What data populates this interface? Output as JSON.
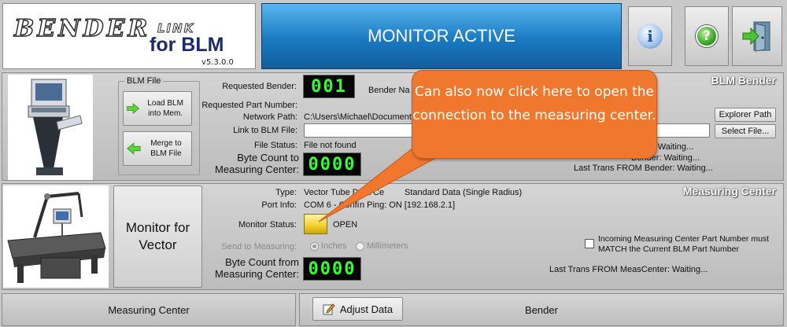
{
  "header": {
    "logo_word": "BENDER",
    "logo_link": "LINK",
    "logo_sub": "for BLM",
    "version": "v5.3.0.0",
    "banner": "MONITOR ACTIVE"
  },
  "blm_bender": {
    "title": "BLM Bender",
    "blm_file_group": "BLM File",
    "load_label": "Load BLM into Mem.",
    "merge_label": "Merge to BLM File",
    "requested_bender_label": "Requested Bender:",
    "requested_bender_value": "001",
    "bender_name_label": "Bender Na",
    "requested_part_label": "Requested Part Number:",
    "network_path_label": "Network Path:",
    "network_path_value": "C:\\Users\\Michael\\Documents",
    "link_file_label": "Link to BLM File:",
    "file_status_label": "File Status:",
    "file_status_value": "File not found",
    "byte_count_label": "Byte Count to Measuring Center:",
    "byte_count_value": "0000",
    "explorer_button": "Explorer Path",
    "select_file_button": "Select File...",
    "trans_line1": "r: Waiting...",
    "trans_line2": "Bender: Waiting...",
    "trans_line3": "Last Trans FROM Bender: Waiting..."
  },
  "measuring_center": {
    "title": "Measuring Center",
    "monitor_button": "Monitor for Vector",
    "type_label": "Type:",
    "type_value": "Vector Tube Data Ce",
    "type_value2": "Standard Data (Single Radius)",
    "port_label": "Port Info:",
    "port_value": "COM 6 - Confi",
    "port_value2": "n Ping: ON [192.168.2.1]",
    "monitor_status_label": "Monitor Status:",
    "monitor_status_value": "OPEN",
    "send_label": "Send to Measuring:",
    "inches": "Inches",
    "millimeters": "Millimeters",
    "byte_count_label": "Byte Count from Measuring Center:",
    "byte_count_value": "0000",
    "incoming_check": "Incoming Measuring Center Part Number must MATCH the Current BLM Part Number",
    "last_trans": "Last Trans FROM MeasCenter:  Waiting..."
  },
  "callout": {
    "text": "Can also now click here to open the connection to the measuring center."
  },
  "bottom": {
    "left_tab": "Measuring Center",
    "adjust_button": "Adjust Data",
    "right_tab": "Bender"
  },
  "icons": {
    "info": "info-icon",
    "help": "help-icon",
    "exit": "exit-door-icon"
  },
  "colors": {
    "banner": "#1a7ac2",
    "callout": "#f0782e",
    "segment": "#35ff35",
    "status_lamp": "#f2d12a"
  }
}
